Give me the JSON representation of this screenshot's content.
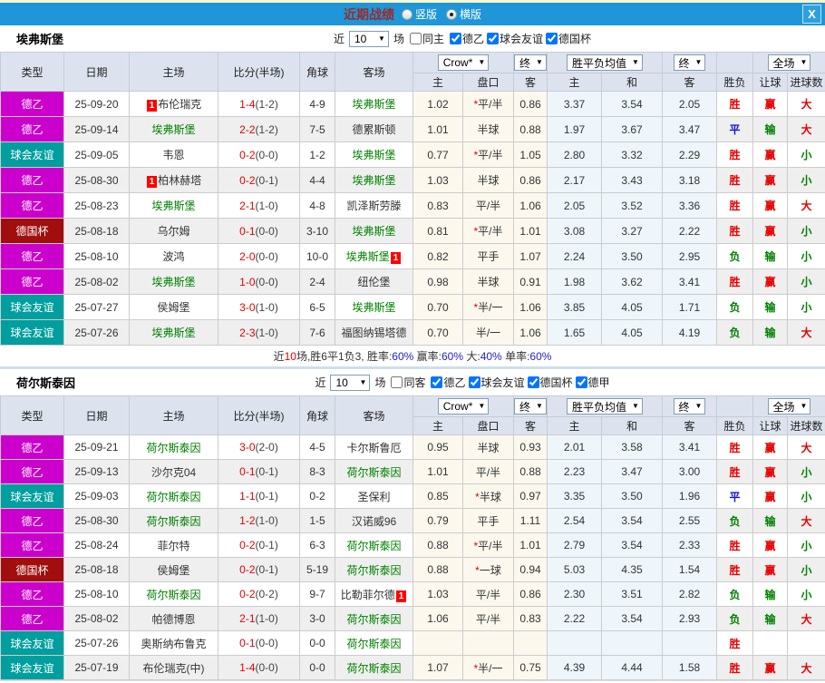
{
  "titlebar": {
    "title": "近期战绩",
    "layout_options": [
      {
        "label": "竖版",
        "selected": false
      },
      {
        "label": "横版",
        "selected": true
      }
    ],
    "close_label": "X"
  },
  "filters": {
    "near_label": "近",
    "games_count": "10",
    "games_suffix": "场"
  },
  "table_headers": {
    "cols": [
      "类型",
      "日期",
      "主场",
      "比分(半场)",
      "角球",
      "客场"
    ],
    "odds_source": "Crow*",
    "final_label": "终",
    "mean_label": "胜平负均值",
    "scope_label": "全场",
    "odds_sub": [
      "主",
      "盘口",
      "客"
    ],
    "mean_sub": [
      "主",
      "和",
      "客"
    ],
    "result_sub": [
      "胜负",
      "让球",
      "进球数"
    ]
  },
  "card_label": "1",
  "star_label": "*",
  "type_colors": {
    "德乙": "#cc00cc",
    "球会友谊": "#009e9e",
    "德国杯": "#a00e0e",
    "德甲": "#d88000"
  },
  "result_colors": {
    "胜": "#e60000",
    "平": "#1414cc",
    "负": "#008000",
    "赢": "#e60000",
    "输": "#008000",
    "大": "#e60000",
    "小": "#008000"
  },
  "palette": {
    "titlebar_bg": "#1e96d7",
    "title_text": "#9c2a2a",
    "header_bg": "#dde3ee",
    "row_alt_bg": "#efefef",
    "odds_bg": "#fcf8ee",
    "mean_bg": "#eef6fc",
    "focus_team": "#008000",
    "score": "#e60000",
    "card_bg": "#fe0000",
    "percent": "#2222cc"
  },
  "sections": [
    {
      "team": "埃弗斯堡",
      "same_label": "同主",
      "same_checked": false,
      "leagues": [
        {
          "label": "德乙",
          "checked": true
        },
        {
          "label": "球会友谊",
          "checked": true
        },
        {
          "label": "德国杯",
          "checked": true
        }
      ],
      "rows": [
        {
          "type": "德乙",
          "date": "25-09-20",
          "home": "布伦瑞克",
          "home_green": false,
          "home_card": true,
          "score": "1-4",
          "half": "(1-2)",
          "corner": "4-9",
          "away": "埃弗斯堡",
          "away_green": true,
          "away_card": false,
          "odds_home": "1.02",
          "handicap_star": true,
          "handicap": "平/半",
          "odds_away": "0.86",
          "mean_home": "3.37",
          "mean_draw": "3.54",
          "mean_away": "2.05",
          "result": "胜",
          "handicap_result": "赢",
          "goals_result": "大"
        },
        {
          "type": "德乙",
          "date": "25-09-14",
          "home": "埃弗斯堡",
          "home_green": true,
          "home_card": false,
          "score": "2-2",
          "half": "(1-2)",
          "corner": "7-5",
          "away": "德累斯顿",
          "away_green": false,
          "away_card": false,
          "odds_home": "1.01",
          "handicap_star": false,
          "handicap": "半球",
          "odds_away": "0.88",
          "mean_home": "1.97",
          "mean_draw": "3.67",
          "mean_away": "3.47",
          "result": "平",
          "handicap_result": "输",
          "goals_result": "大"
        },
        {
          "type": "球会友谊",
          "date": "25-09-05",
          "home": "韦恩",
          "home_green": false,
          "home_card": false,
          "score": "0-2",
          "half": "(0-0)",
          "corner": "1-2",
          "away": "埃弗斯堡",
          "away_green": true,
          "away_card": false,
          "odds_home": "0.77",
          "handicap_star": true,
          "handicap": "平/半",
          "odds_away": "1.05",
          "mean_home": "2.80",
          "mean_draw": "3.32",
          "mean_away": "2.29",
          "result": "胜",
          "handicap_result": "赢",
          "goals_result": "小"
        },
        {
          "type": "德乙",
          "date": "25-08-30",
          "home": "柏林赫塔",
          "home_green": false,
          "home_card": true,
          "score": "0-2",
          "half": "(0-1)",
          "corner": "4-4",
          "away": "埃弗斯堡",
          "away_green": true,
          "away_card": false,
          "odds_home": "1.03",
          "handicap_star": false,
          "handicap": "半球",
          "odds_away": "0.86",
          "mean_home": "2.17",
          "mean_draw": "3.43",
          "mean_away": "3.18",
          "result": "胜",
          "handicap_result": "赢",
          "goals_result": "小"
        },
        {
          "type": "德乙",
          "date": "25-08-23",
          "home": "埃弗斯堡",
          "home_green": true,
          "home_card": false,
          "score": "2-1",
          "half": "(1-0)",
          "corner": "4-8",
          "away": "凯泽斯劳滕",
          "away_green": false,
          "away_card": false,
          "odds_home": "0.83",
          "handicap_star": false,
          "handicap": "平/半",
          "odds_away": "1.06",
          "mean_home": "2.05",
          "mean_draw": "3.52",
          "mean_away": "3.36",
          "result": "胜",
          "handicap_result": "赢",
          "goals_result": "大"
        },
        {
          "type": "德国杯",
          "date": "25-08-18",
          "home": "乌尔姆",
          "home_green": false,
          "home_card": false,
          "score": "0-1",
          "half": "(0-0)",
          "corner": "3-10",
          "away": "埃弗斯堡",
          "away_green": true,
          "away_card": false,
          "odds_home": "0.81",
          "handicap_star": true,
          "handicap": "平/半",
          "odds_away": "1.01",
          "mean_home": "3.08",
          "mean_draw": "3.27",
          "mean_away": "2.22",
          "result": "胜",
          "handicap_result": "赢",
          "goals_result": "小"
        },
        {
          "type": "德乙",
          "date": "25-08-10",
          "home": "波鸿",
          "home_green": false,
          "home_card": false,
          "score": "2-0",
          "half": "(0-0)",
          "corner": "10-0",
          "away": "埃弗斯堡",
          "away_green": true,
          "away_card": true,
          "odds_home": "0.82",
          "handicap_star": false,
          "handicap": "平手",
          "odds_away": "1.07",
          "mean_home": "2.24",
          "mean_draw": "3.50",
          "mean_away": "2.95",
          "result": "负",
          "handicap_result": "输",
          "goals_result": "小"
        },
        {
          "type": "德乙",
          "date": "25-08-02",
          "home": "埃弗斯堡",
          "home_green": true,
          "home_card": false,
          "score": "1-0",
          "half": "(0-0)",
          "corner": "2-4",
          "away": "纽伦堡",
          "away_green": false,
          "away_card": false,
          "odds_home": "0.98",
          "handicap_star": false,
          "handicap": "半球",
          "odds_away": "0.91",
          "mean_home": "1.98",
          "mean_draw": "3.62",
          "mean_away": "3.41",
          "result": "胜",
          "handicap_result": "赢",
          "goals_result": "小"
        },
        {
          "type": "球会友谊",
          "date": "25-07-27",
          "home": "侯姆堡",
          "home_green": false,
          "home_card": false,
          "score": "3-0",
          "half": "(1-0)",
          "corner": "6-5",
          "away": "埃弗斯堡",
          "away_green": true,
          "away_card": false,
          "odds_home": "0.70",
          "handicap_star": true,
          "handicap": "半/一",
          "odds_away": "1.06",
          "mean_home": "3.85",
          "mean_draw": "4.05",
          "mean_away": "1.71",
          "result": "负",
          "handicap_result": "输",
          "goals_result": "小"
        },
        {
          "type": "球会友谊",
          "date": "25-07-26",
          "home": "埃弗斯堡",
          "home_green": true,
          "home_card": false,
          "score": "2-3",
          "half": "(1-0)",
          "corner": "7-6",
          "away": "福图纳锡塔德",
          "away_green": false,
          "away_card": false,
          "odds_home": "0.70",
          "handicap_star": false,
          "handicap": "半/一",
          "odds_away": "1.06",
          "mean_home": "1.65",
          "mean_draw": "4.05",
          "mean_away": "4.19",
          "result": "负",
          "handicap_result": "输",
          "goals_result": "大"
        }
      ],
      "summary": [
        {
          "text": "近",
          "color": "#333333"
        },
        {
          "text": "10",
          "color": "#e60000"
        },
        {
          "text": "场,胜6平1负3, 胜率:",
          "color": "#333333"
        },
        {
          "text": "60%",
          "color": "#2222cc"
        },
        {
          "text": " 赢率:",
          "color": "#333333"
        },
        {
          "text": "60%",
          "color": "#2222cc"
        },
        {
          "text": " 大:",
          "color": "#333333"
        },
        {
          "text": "40%",
          "color": "#2222cc"
        },
        {
          "text": " 单率:",
          "color": "#333333"
        },
        {
          "text": "60%",
          "color": "#2222cc"
        }
      ]
    },
    {
      "team": "荷尔斯泰因",
      "same_label": "同客",
      "same_checked": false,
      "leagues": [
        {
          "label": "德乙",
          "checked": true
        },
        {
          "label": "球会友谊",
          "checked": true
        },
        {
          "label": "德国杯",
          "checked": true
        },
        {
          "label": "德甲",
          "checked": true
        }
      ],
      "rows": [
        {
          "type": "德乙",
          "date": "25-09-21",
          "home": "荷尔斯泰因",
          "home_green": true,
          "home_card": false,
          "score": "3-0",
          "half": "(2-0)",
          "corner": "4-5",
          "away": "卡尔斯鲁厄",
          "away_green": false,
          "away_card": false,
          "odds_home": "0.95",
          "handicap_star": false,
          "handicap": "半球",
          "odds_away": "0.93",
          "mean_home": "2.01",
          "mean_draw": "3.58",
          "mean_away": "3.41",
          "result": "胜",
          "handicap_result": "赢",
          "goals_result": "大"
        },
        {
          "type": "德乙",
          "date": "25-09-13",
          "home": "沙尔克04",
          "home_green": false,
          "home_card": false,
          "score": "0-1",
          "half": "(0-1)",
          "corner": "8-3",
          "away": "荷尔斯泰因",
          "away_green": true,
          "away_card": false,
          "odds_home": "1.01",
          "handicap_star": false,
          "handicap": "平/半",
          "odds_away": "0.88",
          "mean_home": "2.23",
          "mean_draw": "3.47",
          "mean_away": "3.00",
          "result": "胜",
          "handicap_result": "赢",
          "goals_result": "小"
        },
        {
          "type": "球会友谊",
          "date": "25-09-03",
          "home": "荷尔斯泰因",
          "home_green": true,
          "home_card": false,
          "score": "1-1",
          "half": "(0-1)",
          "corner": "0-2",
          "away": "圣保利",
          "away_green": false,
          "away_card": false,
          "odds_home": "0.85",
          "handicap_star": true,
          "handicap": "半球",
          "odds_away": "0.97",
          "mean_home": "3.35",
          "mean_draw": "3.50",
          "mean_away": "1.96",
          "result": "平",
          "handicap_result": "赢",
          "goals_result": "小"
        },
        {
          "type": "德乙",
          "date": "25-08-30",
          "home": "荷尔斯泰因",
          "home_green": true,
          "home_card": false,
          "score": "1-2",
          "half": "(1-0)",
          "corner": "1-5",
          "away": "汉诺威96",
          "away_green": false,
          "away_card": false,
          "odds_home": "0.79",
          "handicap_star": false,
          "handicap": "平手",
          "odds_away": "1.11",
          "mean_home": "2.54",
          "mean_draw": "3.54",
          "mean_away": "2.55",
          "result": "负",
          "handicap_result": "输",
          "goals_result": "大"
        },
        {
          "type": "德乙",
          "date": "25-08-24",
          "home": "菲尔特",
          "home_green": false,
          "home_card": false,
          "score": "0-2",
          "half": "(0-1)",
          "corner": "6-3",
          "away": "荷尔斯泰因",
          "away_green": true,
          "away_card": false,
          "odds_home": "0.88",
          "handicap_star": true,
          "handicap": "平/半",
          "odds_away": "1.01",
          "mean_home": "2.79",
          "mean_draw": "3.54",
          "mean_away": "2.33",
          "result": "胜",
          "handicap_result": "赢",
          "goals_result": "小"
        },
        {
          "type": "德国杯",
          "date": "25-08-18",
          "home": "侯姆堡",
          "home_green": false,
          "home_card": false,
          "score": "0-2",
          "half": "(0-1)",
          "corner": "5-19",
          "away": "荷尔斯泰因",
          "away_green": true,
          "away_card": false,
          "odds_home": "0.88",
          "handicap_star": true,
          "handicap": "一球",
          "odds_away": "0.94",
          "mean_home": "5.03",
          "mean_draw": "4.35",
          "mean_away": "1.54",
          "result": "胜",
          "handicap_result": "赢",
          "goals_result": "小"
        },
        {
          "type": "德乙",
          "date": "25-08-10",
          "home": "荷尔斯泰因",
          "home_green": true,
          "home_card": false,
          "score": "0-2",
          "half": "(0-2)",
          "corner": "9-7",
          "away": "比勒菲尔德",
          "away_green": false,
          "away_card": true,
          "odds_home": "1.03",
          "handicap_star": false,
          "handicap": "平/半",
          "odds_away": "0.86",
          "mean_home": "2.30",
          "mean_draw": "3.51",
          "mean_away": "2.82",
          "result": "负",
          "handicap_result": "输",
          "goals_result": "小"
        },
        {
          "type": "德乙",
          "date": "25-08-02",
          "home": "帕德博恩",
          "home_green": false,
          "home_card": false,
          "score": "2-1",
          "half": "(1-0)",
          "corner": "3-0",
          "away": "荷尔斯泰因",
          "away_green": true,
          "away_card": false,
          "odds_home": "1.06",
          "handicap_star": false,
          "handicap": "平/半",
          "odds_away": "0.83",
          "mean_home": "2.22",
          "mean_draw": "3.54",
          "mean_away": "2.93",
          "result": "负",
          "handicap_result": "输",
          "goals_result": "大"
        },
        {
          "type": "球会友谊",
          "date": "25-07-26",
          "home": "奥斯纳布鲁克",
          "home_green": false,
          "home_card": false,
          "score": "0-1",
          "half": "(0-0)",
          "corner": "0-0",
          "away": "荷尔斯泰因",
          "away_green": true,
          "away_card": false,
          "odds_home": "",
          "handicap_star": false,
          "handicap": "",
          "odds_away": "",
          "mean_home": "",
          "mean_draw": "",
          "mean_away": "",
          "result": "胜",
          "handicap_result": "",
          "goals_result": ""
        },
        {
          "type": "球会友谊",
          "date": "25-07-19",
          "home": "布伦瑞克(中)",
          "home_green": false,
          "home_card": false,
          "score": "1-4",
          "half": "(0-0)",
          "corner": "0-0",
          "away": "荷尔斯泰因",
          "away_green": true,
          "away_card": false,
          "odds_home": "1.07",
          "handicap_star": true,
          "handicap": "半/一",
          "odds_away": "0.75",
          "mean_home": "4.39",
          "mean_draw": "4.44",
          "mean_away": "1.58",
          "result": "胜",
          "handicap_result": "赢",
          "goals_result": "大"
        }
      ],
      "summary": null
    }
  ]
}
